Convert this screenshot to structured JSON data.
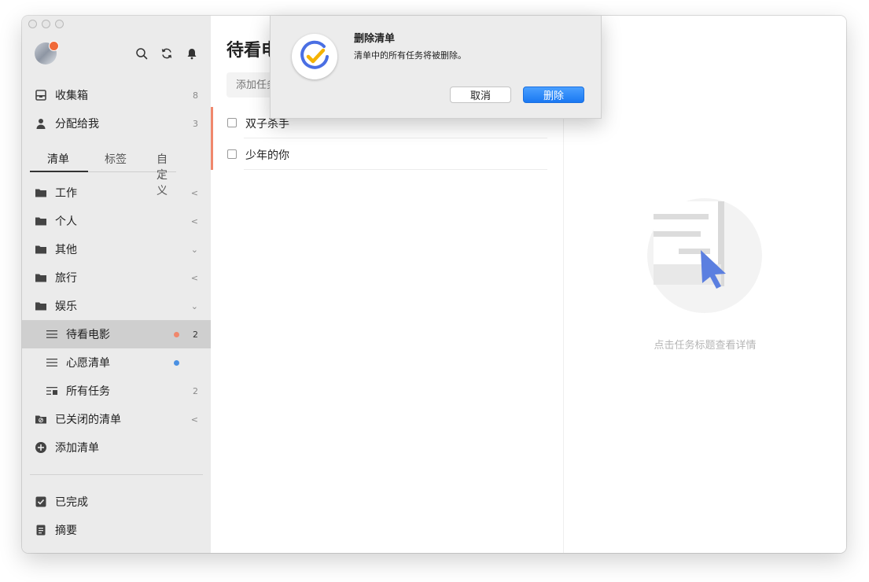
{
  "sidebar": {
    "header_icons": [
      "search-icon",
      "sync-icon",
      "bell-icon"
    ],
    "smart": [
      {
        "label": "收集箱",
        "count": "8",
        "icon": "inbox-icon"
      },
      {
        "label": "分配给我",
        "count": "3",
        "icon": "person-icon"
      }
    ],
    "tabs": [
      "清单",
      "标签",
      "自定义"
    ],
    "active_tab": "清单",
    "folders": [
      {
        "label": "工作",
        "chevron": "<",
        "icon": "folder-icon"
      },
      {
        "label": "个人",
        "chevron": "<",
        "icon": "folder-icon"
      },
      {
        "label": "其他",
        "chevron": "⌄",
        "icon": "folder-icon"
      },
      {
        "label": "旅行",
        "chevron": "<",
        "icon": "folder-icon"
      },
      {
        "label": "娱乐",
        "chevron": "⌄",
        "icon": "folder-icon"
      }
    ],
    "lists": [
      {
        "label": "待看电影",
        "count": "2",
        "dot_color": "#f0876c",
        "active": true
      },
      {
        "label": "心愿清单",
        "count": "",
        "dot_color": "#4a90e2",
        "active": false
      },
      {
        "label": "所有任务",
        "count": "2",
        "dot_color": "",
        "active": false
      }
    ],
    "closed_lists": {
      "label": "已关闭的清单",
      "chevron": "<"
    },
    "add_list": "添加清单",
    "bottom": [
      {
        "label": "已完成",
        "icon": "checkbox-checked-icon"
      },
      {
        "label": "摘要",
        "icon": "summary-icon"
      }
    ]
  },
  "list_pane": {
    "title": "待看电",
    "add_task_placeholder": "添加任务",
    "tasks": [
      "双子杀手",
      "少年的你"
    ],
    "accent_color": "#f0876c"
  },
  "detail_pane": {
    "empty_text": "点击任务标题查看详情"
  },
  "dialog": {
    "title": "删除清单",
    "message": "清单中的所有任务将被删除。",
    "cancel_label": "取消",
    "delete_label": "删除",
    "icon": "app-logo-icon"
  }
}
